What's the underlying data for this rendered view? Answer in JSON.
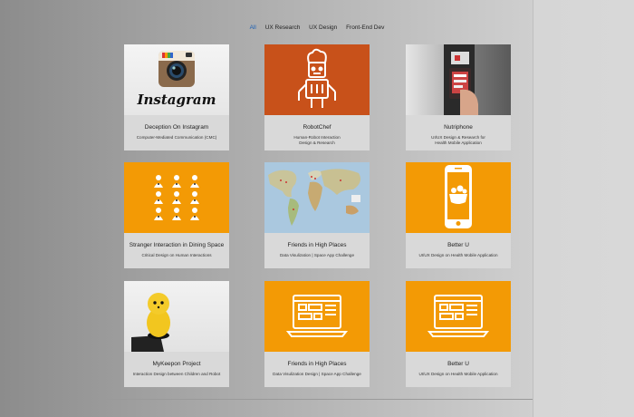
{
  "filters": [
    {
      "label": "All"
    },
    {
      "label": "UX Research"
    },
    {
      "label": "UX Design"
    },
    {
      "label": "Front-End Dev"
    }
  ],
  "colors": {
    "accent": "#1a5fb4",
    "orange": "#f39a05",
    "rust": "#c8511a",
    "card": "#d9d9d9"
  },
  "cards": [
    {
      "title": "Deception On Instagram",
      "subtitle": "Computer-Mediated Communication (CMC)",
      "thumb_label": "Instagram"
    },
    {
      "title": "RobotChef",
      "subtitle": "Human-Robot Interaction\nDesign & Research"
    },
    {
      "title": "Nutriphone",
      "subtitle": "UI/UX Design & Research for\nHealth Mobile Application"
    },
    {
      "title": "Stranger Interaction in Dining Space",
      "subtitle": "Critical Design on Human Interactions"
    },
    {
      "title": "Friends in High Places",
      "subtitle": "Data Visulization | Space App Challenge"
    },
    {
      "title": "Better U",
      "subtitle": "UI/UX Design on Health Mobile Application"
    },
    {
      "title": "MyKeepon Project",
      "subtitle": "Interaction Design between Children and Robot"
    },
    {
      "title": "Friends in High Places",
      "subtitle": "Data Visulization Design | Space App Challenge"
    },
    {
      "title": "Better U",
      "subtitle": "UI/UX Design on Health Mobile Application"
    }
  ]
}
